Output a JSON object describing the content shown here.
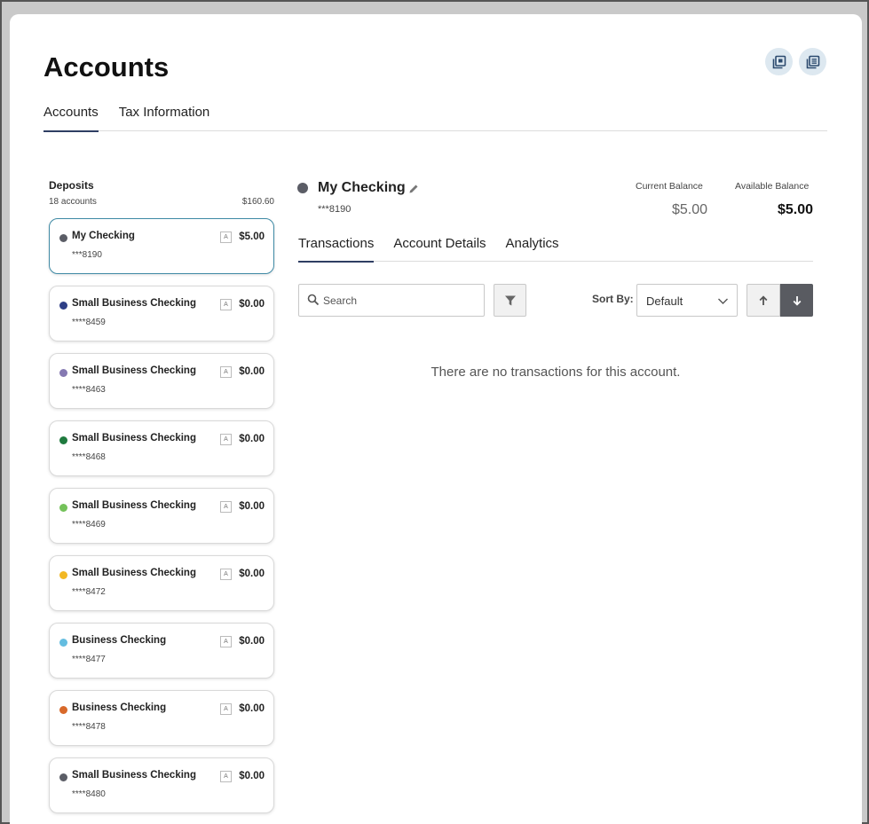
{
  "page": {
    "title": "Accounts"
  },
  "top_tabs": [
    {
      "label": "Accounts",
      "active": true
    },
    {
      "label": "Tax Information",
      "active": false
    }
  ],
  "deposits": {
    "title": "Deposits",
    "count": "18 accounts",
    "total": "$160.60",
    "accounts": [
      {
        "name": "My Checking",
        "number": "***8190",
        "amount": "$5.00",
        "color": "#5b5d66",
        "badge": "A",
        "selected": true
      },
      {
        "name": "Small Business Checking",
        "number": "****8459",
        "amount": "$0.00",
        "color": "#2e3f86",
        "badge": "A"
      },
      {
        "name": "Small Business Checking",
        "number": "****8463",
        "amount": "$0.00",
        "color": "#8579b2",
        "badge": "A"
      },
      {
        "name": "Small Business Checking",
        "number": "****8468",
        "amount": "$0.00",
        "color": "#1f7a3e",
        "badge": "A"
      },
      {
        "name": "Small Business Checking",
        "number": "****8469",
        "amount": "$0.00",
        "color": "#74c25a",
        "badge": "A"
      },
      {
        "name": "Small Business Checking",
        "number": "****8472",
        "amount": "$0.00",
        "color": "#f2b824",
        "badge": "A"
      },
      {
        "name": "Business Checking",
        "number": "****8477",
        "amount": "$0.00",
        "color": "#64bde0",
        "badge": "A"
      },
      {
        "name": "Business Checking",
        "number": "****8478",
        "amount": "$0.00",
        "color": "#d8692a",
        "badge": "A"
      },
      {
        "name": "Small Business Checking",
        "number": "****8480",
        "amount": "$0.00",
        "color": "#5b5d66",
        "badge": "A"
      }
    ]
  },
  "detail": {
    "name": "My Checking",
    "number": "***8190",
    "current_balance_label": "Current Balance",
    "current_balance": "$5.00",
    "available_balance_label": "Available Balance",
    "available_balance": "$5.00",
    "tabs": [
      {
        "label": "Transactions",
        "active": true
      },
      {
        "label": "Account Details",
        "active": false
      },
      {
        "label": "Analytics",
        "active": false
      }
    ],
    "search_placeholder": "Search",
    "sort_label": "Sort By:",
    "sort_value": "Default",
    "empty_message": "There are no transactions for this account."
  },
  "icons": {
    "header_1": "export-icon",
    "header_2": "print-icon",
    "search": "search-icon",
    "filter": "filter-icon",
    "edit": "pencil-icon",
    "sort_asc": "arrow-up-icon",
    "sort_desc": "arrow-down-icon",
    "dropdown": "chevron-down-icon"
  }
}
